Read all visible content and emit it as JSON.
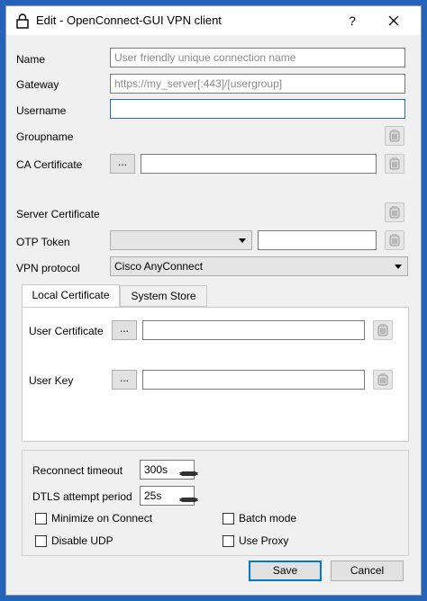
{
  "window": {
    "title": "Edit - OpenConnect-GUI VPN client",
    "help": "?"
  },
  "form": {
    "name_label": "Name",
    "name_placeholder": "User friendly unique connection name",
    "gateway_label": "Gateway",
    "gateway_placeholder": "https://my_server[:443]/[usergroup]",
    "username_label": "Username",
    "username_value": "",
    "groupname_label": "Groupname",
    "ca_label": "CA Certificate",
    "ca_value": "",
    "browse_label": "...",
    "server_cert_label": "Server Certificate",
    "otp_label": "OTP Token",
    "otp_type_value": "",
    "otp_value": "",
    "vpn_protocol_label": "VPN protocol",
    "vpn_protocol_value": "Cisco AnyConnect"
  },
  "tabs": [
    {
      "label": "Local Certificate",
      "active": true
    },
    {
      "label": "System Store",
      "active": false
    }
  ],
  "local_cert": {
    "user_cert_label": "User Certificate",
    "user_cert_value": "",
    "user_key_label": "User Key",
    "user_key_value": ""
  },
  "options": {
    "reconnect_label": "Reconnect timeout",
    "reconnect_value": "300s",
    "dtls_label": "DTLS attempt period",
    "dtls_value": "25s",
    "minimize_label": "Minimize on Connect",
    "batch_label": "Batch mode",
    "disable_udp_label": "Disable UDP",
    "use_proxy_label": "Use Proxy"
  },
  "buttons": {
    "save": "Save",
    "cancel": "Cancel"
  },
  "icons": {
    "window": "lock-icon",
    "close": "close-icon",
    "key": "key-icon"
  },
  "colors": {
    "accent": "#0078d7",
    "focus_border": "#1e6fd6",
    "desktop": "#2563b8"
  }
}
